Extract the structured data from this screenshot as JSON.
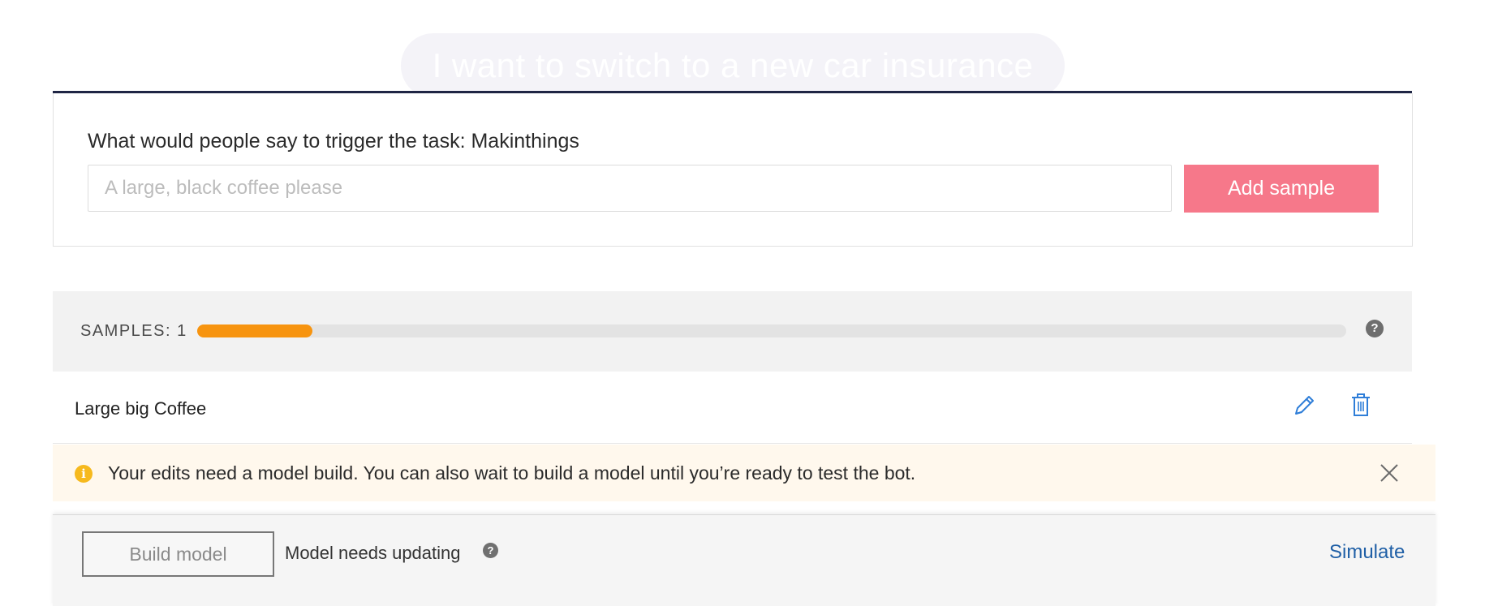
{
  "header": {
    "ghost_text": "I want to switch to a new car insurance"
  },
  "trigger": {
    "title": "What would people say to trigger the task: Makinthings",
    "input_placeholder": "A large, black coffee please",
    "input_value": "",
    "add_button_label": "Add sample"
  },
  "samples": {
    "label": "SAMPLES: 1",
    "progress_fraction": 0.1,
    "help_icon": "question-circle-icon",
    "items": [
      {
        "text": "Large big Coffee",
        "edit_icon": "pencil-icon",
        "delete_icon": "trash-icon"
      }
    ]
  },
  "notice": {
    "icon": "info-icon",
    "text": "Your edits need a model build. You can also wait to build a model until you’re ready to test the bot.",
    "close_icon": "close-icon"
  },
  "footer": {
    "build_button_label": "Build model",
    "status_text": "Model needs updating",
    "simulate_label": "Simulate"
  },
  "colors": {
    "accent_button": "#f6788a",
    "progress": "#f7940f",
    "link": "#1f5fa6",
    "icon_blue": "#2f7ed8",
    "notice_bg": "#fff8ed",
    "notice_icon": "#f6b91d"
  }
}
